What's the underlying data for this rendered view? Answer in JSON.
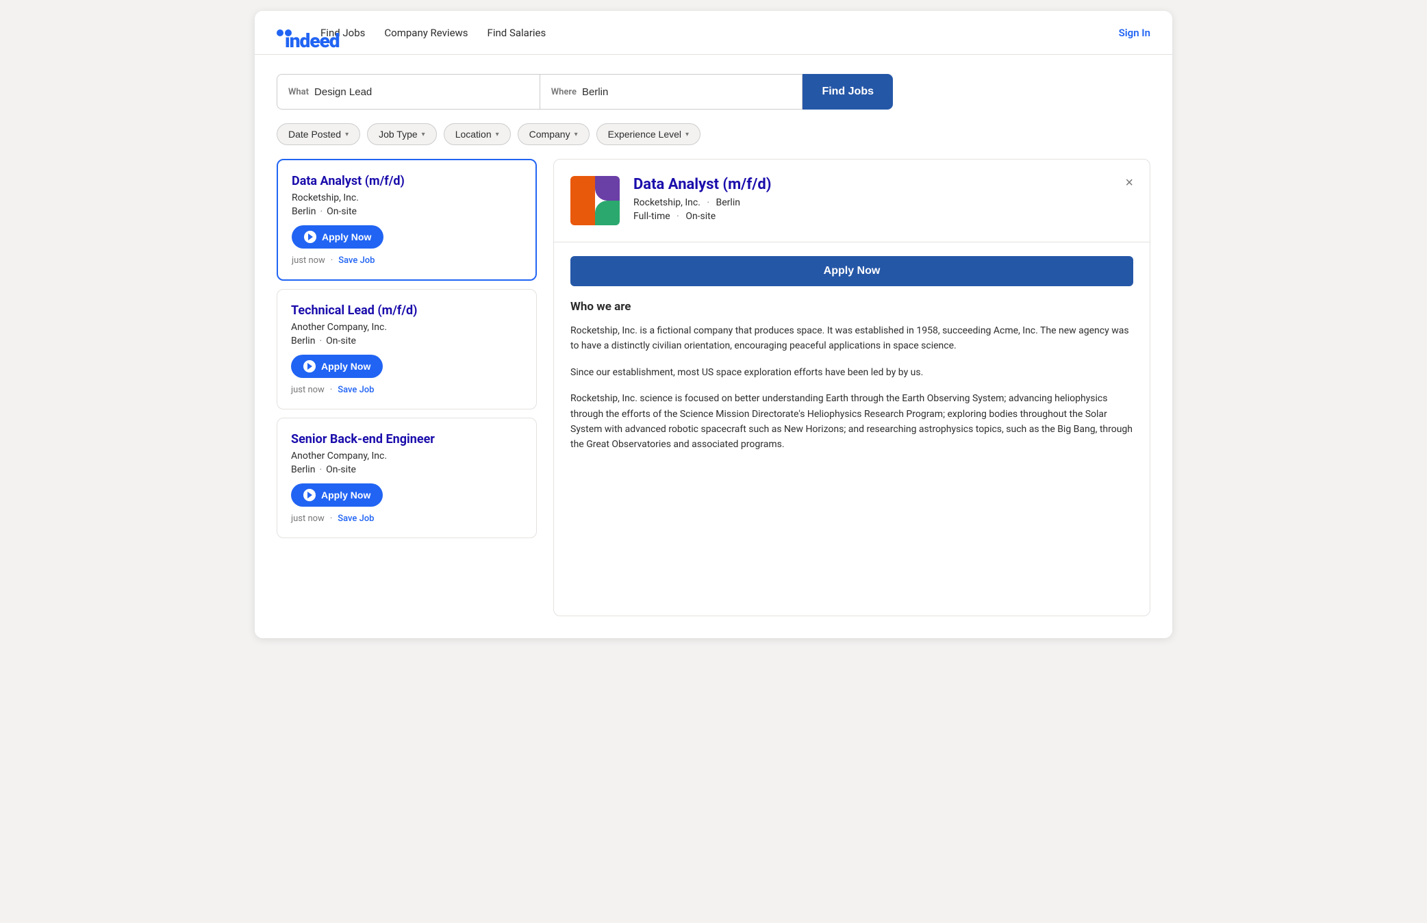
{
  "nav": {
    "logo": "indeed",
    "links": [
      "Find Jobs",
      "Company Reviews",
      "Find Salaries"
    ],
    "sign_in": "Sign In"
  },
  "search": {
    "what_label": "What",
    "what_placeholder": "Design Lead",
    "where_label": "Where",
    "where_placeholder": "Berlin",
    "find_jobs_btn": "Find Jobs"
  },
  "filters": [
    {
      "label": "Date Posted"
    },
    {
      "label": "Job Type"
    },
    {
      "label": "Location"
    },
    {
      "label": "Company"
    },
    {
      "label": "Experience Level"
    }
  ],
  "job_list": [
    {
      "id": 1,
      "title": "Data Analyst (m/f/d)",
      "company": "Rocketship, Inc.",
      "location": "Berlin",
      "work_type": "On-site",
      "apply_label": "Apply Now",
      "posted": "just now",
      "save_label": "Save Job",
      "selected": true
    },
    {
      "id": 2,
      "title": "Technical Lead (m/f/d)",
      "company": "Another Company, Inc.",
      "location": "Berlin",
      "work_type": "On-site",
      "apply_label": "Apply Now",
      "posted": "just now",
      "save_label": "Save Job",
      "selected": false
    },
    {
      "id": 3,
      "title": "Senior Back-end Engineer",
      "company": "Another Company, Inc.",
      "location": "Berlin",
      "work_type": "On-site",
      "apply_label": "Apply Now",
      "posted": "just now",
      "save_label": "Save Job",
      "selected": false
    }
  ],
  "job_detail": {
    "title": "Data Analyst (m/f/d)",
    "company": "Rocketship, Inc.",
    "location": "Berlin",
    "job_type": "Full-time",
    "work_type": "On-site",
    "apply_label": "Apply Now",
    "close_icon": "×",
    "who_we_are_title": "Who we are",
    "description_1": "Rocketship, Inc. is a fictional company that produces space. It was established in 1958, succeeding Acme, Inc. The new agency was to have a distinctly civilian orientation, encouraging peaceful applications in space science.",
    "description_2": "Since our establishment, most US space exploration efforts have been led by by us.",
    "description_3": "Rocketship, Inc. science is focused on better understanding Earth through the Earth Observing System; advancing heliophysics through the efforts of the Science Mission Directorate's Heliophysics Research Program; exploring bodies throughout the Solar System with advanced robotic spacecraft such as New Horizons; and researching astrophysics topics, such as the Big Bang, through the Great Observatories and associated programs."
  }
}
